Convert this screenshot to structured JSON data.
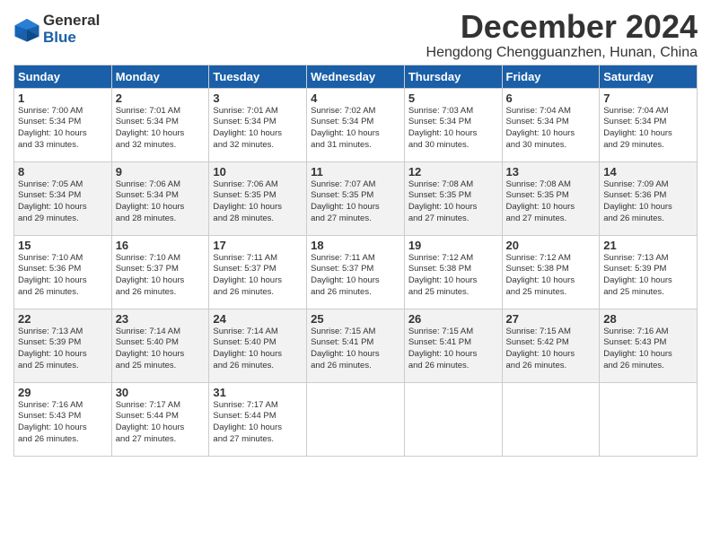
{
  "header": {
    "logo_line1": "General",
    "logo_line2": "Blue",
    "month_title": "December 2024",
    "location": "Hengdong Chengguanzhen, Hunan, China"
  },
  "weekdays": [
    "Sunday",
    "Monday",
    "Tuesday",
    "Wednesday",
    "Thursday",
    "Friday",
    "Saturday"
  ],
  "weeks": [
    [
      {
        "day": "1",
        "sunrise": "7:00 AM",
        "sunset": "5:34 PM",
        "daylight": "10 hours and 33 minutes."
      },
      {
        "day": "2",
        "sunrise": "7:01 AM",
        "sunset": "5:34 PM",
        "daylight": "10 hours and 32 minutes."
      },
      {
        "day": "3",
        "sunrise": "7:01 AM",
        "sunset": "5:34 PM",
        "daylight": "10 hours and 32 minutes."
      },
      {
        "day": "4",
        "sunrise": "7:02 AM",
        "sunset": "5:34 PM",
        "daylight": "10 hours and 31 minutes."
      },
      {
        "day": "5",
        "sunrise": "7:03 AM",
        "sunset": "5:34 PM",
        "daylight": "10 hours and 30 minutes."
      },
      {
        "day": "6",
        "sunrise": "7:04 AM",
        "sunset": "5:34 PM",
        "daylight": "10 hours and 30 minutes."
      },
      {
        "day": "7",
        "sunrise": "7:04 AM",
        "sunset": "5:34 PM",
        "daylight": "10 hours and 29 minutes."
      }
    ],
    [
      {
        "day": "8",
        "sunrise": "7:05 AM",
        "sunset": "5:34 PM",
        "daylight": "10 hours and 29 minutes."
      },
      {
        "day": "9",
        "sunrise": "7:06 AM",
        "sunset": "5:34 PM",
        "daylight": "10 hours and 28 minutes."
      },
      {
        "day": "10",
        "sunrise": "7:06 AM",
        "sunset": "5:35 PM",
        "daylight": "10 hours and 28 minutes."
      },
      {
        "day": "11",
        "sunrise": "7:07 AM",
        "sunset": "5:35 PM",
        "daylight": "10 hours and 27 minutes."
      },
      {
        "day": "12",
        "sunrise": "7:08 AM",
        "sunset": "5:35 PM",
        "daylight": "10 hours and 27 minutes."
      },
      {
        "day": "13",
        "sunrise": "7:08 AM",
        "sunset": "5:35 PM",
        "daylight": "10 hours and 27 minutes."
      },
      {
        "day": "14",
        "sunrise": "7:09 AM",
        "sunset": "5:36 PM",
        "daylight": "10 hours and 26 minutes."
      }
    ],
    [
      {
        "day": "15",
        "sunrise": "7:10 AM",
        "sunset": "5:36 PM",
        "daylight": "10 hours and 26 minutes."
      },
      {
        "day": "16",
        "sunrise": "7:10 AM",
        "sunset": "5:37 PM",
        "daylight": "10 hours and 26 minutes."
      },
      {
        "day": "17",
        "sunrise": "7:11 AM",
        "sunset": "5:37 PM",
        "daylight": "10 hours and 26 minutes."
      },
      {
        "day": "18",
        "sunrise": "7:11 AM",
        "sunset": "5:37 PM",
        "daylight": "10 hours and 26 minutes."
      },
      {
        "day": "19",
        "sunrise": "7:12 AM",
        "sunset": "5:38 PM",
        "daylight": "10 hours and 25 minutes."
      },
      {
        "day": "20",
        "sunrise": "7:12 AM",
        "sunset": "5:38 PM",
        "daylight": "10 hours and 25 minutes."
      },
      {
        "day": "21",
        "sunrise": "7:13 AM",
        "sunset": "5:39 PM",
        "daylight": "10 hours and 25 minutes."
      }
    ],
    [
      {
        "day": "22",
        "sunrise": "7:13 AM",
        "sunset": "5:39 PM",
        "daylight": "10 hours and 25 minutes."
      },
      {
        "day": "23",
        "sunrise": "7:14 AM",
        "sunset": "5:40 PM",
        "daylight": "10 hours and 25 minutes."
      },
      {
        "day": "24",
        "sunrise": "7:14 AM",
        "sunset": "5:40 PM",
        "daylight": "10 hours and 26 minutes."
      },
      {
        "day": "25",
        "sunrise": "7:15 AM",
        "sunset": "5:41 PM",
        "daylight": "10 hours and 26 minutes."
      },
      {
        "day": "26",
        "sunrise": "7:15 AM",
        "sunset": "5:41 PM",
        "daylight": "10 hours and 26 minutes."
      },
      {
        "day": "27",
        "sunrise": "7:15 AM",
        "sunset": "5:42 PM",
        "daylight": "10 hours and 26 minutes."
      },
      {
        "day": "28",
        "sunrise": "7:16 AM",
        "sunset": "5:43 PM",
        "daylight": "10 hours and 26 minutes."
      }
    ],
    [
      {
        "day": "29",
        "sunrise": "7:16 AM",
        "sunset": "5:43 PM",
        "daylight": "10 hours and 26 minutes."
      },
      {
        "day": "30",
        "sunrise": "7:17 AM",
        "sunset": "5:44 PM",
        "daylight": "10 hours and 27 minutes."
      },
      {
        "day": "31",
        "sunrise": "7:17 AM",
        "sunset": "5:44 PM",
        "daylight": "10 hours and 27 minutes."
      },
      null,
      null,
      null,
      null
    ]
  ]
}
